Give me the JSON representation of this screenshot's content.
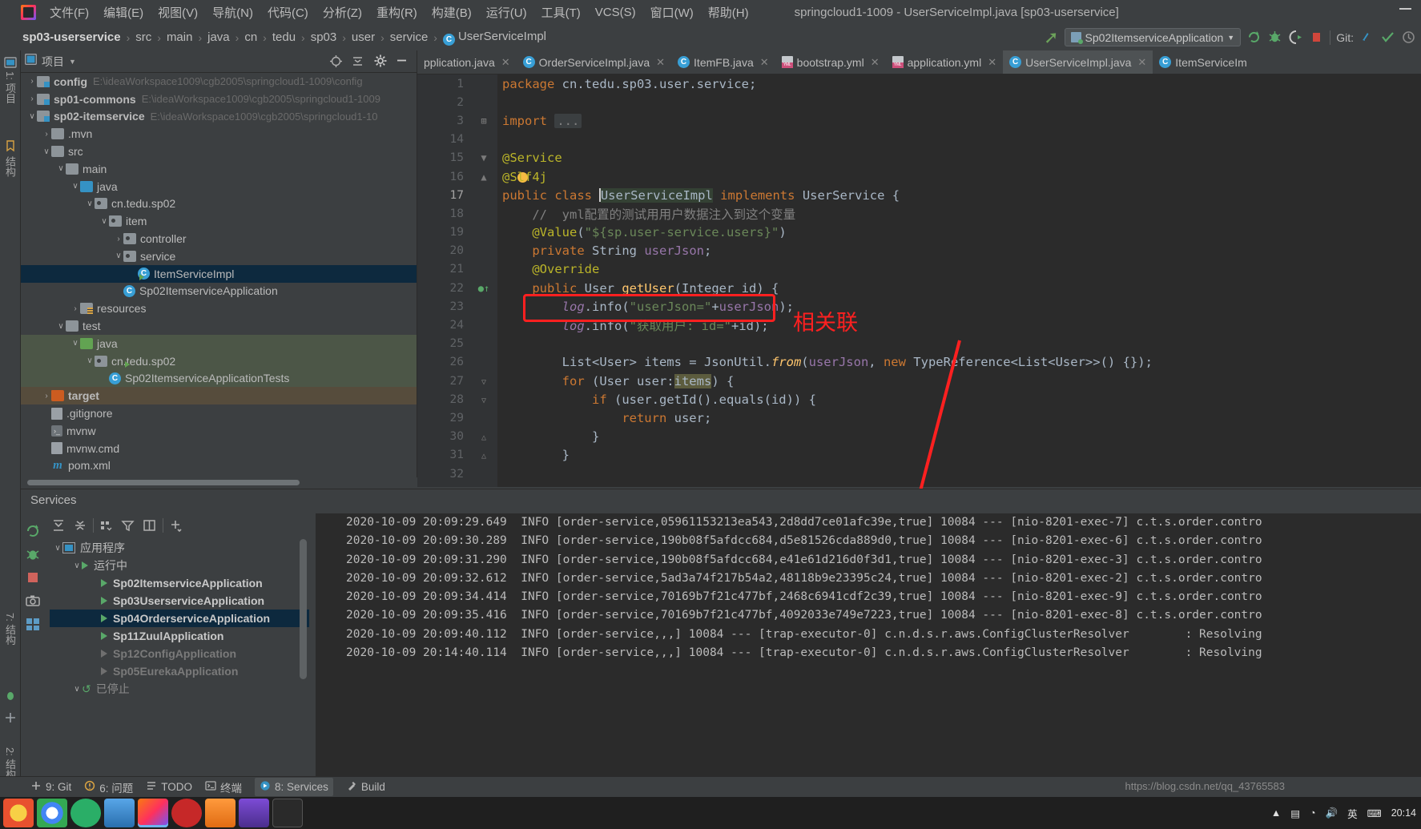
{
  "window": {
    "title": "springcloud1-1009 - UserServiceImpl.java [sp03-userservice]",
    "minimize_label": "—"
  },
  "menubar": {
    "logo": "intellij-logo",
    "items": [
      {
        "label": "文件(F)"
      },
      {
        "label": "编辑(E)"
      },
      {
        "label": "视图(V)"
      },
      {
        "label": "导航(N)"
      },
      {
        "label": "代码(C)"
      },
      {
        "label": "分析(Z)"
      },
      {
        "label": "重构(R)"
      },
      {
        "label": "构建(B)"
      },
      {
        "label": "运行(U)"
      },
      {
        "label": "工具(T)"
      },
      {
        "label": "VCS(S)"
      },
      {
        "label": "窗口(W)"
      },
      {
        "label": "帮助(H)"
      }
    ]
  },
  "navbar": {
    "breadcrumb": [
      "sp03-userservice",
      "src",
      "main",
      "java",
      "cn",
      "tedu",
      "sp03",
      "user",
      "service"
    ],
    "breadcrumb_last": "UserServiceImpl",
    "breadcrumb_last_badge": "C",
    "run_config": "Sp02ItemserviceApplication",
    "git_label": "Git:",
    "icons": [
      "back-arrow-icon",
      "run-config-icon",
      "chevron-down-icon",
      "rerun-icon",
      "debug-icon",
      "run-with-coverage-icon",
      "stop-icon",
      "git-update-icon",
      "git-commit-icon",
      "history-icon"
    ]
  },
  "left_stripe": {
    "top_label": "1: 项目",
    "bottom_labels": [
      "2: 结构",
      "7: 结构"
    ]
  },
  "project_panel": {
    "title": "项目",
    "header_icons": [
      "locate-icon",
      "collapse-all-icon",
      "settings-gear-icon",
      "hide-icon"
    ],
    "tree": [
      {
        "depth": 0,
        "arrow": "›",
        "icon": "module",
        "label": "config",
        "bold": true,
        "path": "E:\\ideaWorkspace1009\\cgb2005\\springcloud1-1009\\config"
      },
      {
        "depth": 0,
        "arrow": "›",
        "icon": "module",
        "label": "sp01-commons",
        "bold": true,
        "path": "E:\\ideaWorkspace1009\\cgb2005\\springcloud1-1009"
      },
      {
        "depth": 0,
        "arrow": "∨",
        "icon": "module",
        "label": "sp02-itemservice",
        "bold": true,
        "path": "E:\\ideaWorkspace1009\\cgb2005\\springcloud1-10"
      },
      {
        "depth": 1,
        "arrow": "›",
        "icon": "folder",
        "label": ".mvn",
        "bold": false,
        "path": ""
      },
      {
        "depth": 1,
        "arrow": "∨",
        "icon": "folder",
        "label": "src",
        "bold": false,
        "path": ""
      },
      {
        "depth": 2,
        "arrow": "∨",
        "icon": "folder",
        "label": "main",
        "bold": false,
        "path": ""
      },
      {
        "depth": 3,
        "arrow": "∨",
        "icon": "src",
        "label": "java",
        "bold": false,
        "path": ""
      },
      {
        "depth": 4,
        "arrow": "∨",
        "icon": "pkg",
        "label": "cn.tedu.sp02",
        "bold": false,
        "path": ""
      },
      {
        "depth": 5,
        "arrow": "∨",
        "icon": "pkg",
        "label": "item",
        "bold": false,
        "path": ""
      },
      {
        "depth": 6,
        "arrow": "›",
        "icon": "pkg",
        "label": "controller",
        "bold": false,
        "path": ""
      },
      {
        "depth": 6,
        "arrow": "∨",
        "icon": "pkg",
        "label": "service",
        "bold": false,
        "path": ""
      },
      {
        "depth": 7,
        "arrow": "",
        "icon": "class",
        "label": "ItemServiceImpl",
        "bold": false,
        "path": "",
        "selected": true
      },
      {
        "depth": 6,
        "arrow": "",
        "icon": "class-run",
        "label": "Sp02ItemserviceApplication",
        "bold": false,
        "path": ""
      },
      {
        "depth": 3,
        "arrow": "›",
        "icon": "res",
        "label": "resources",
        "bold": false,
        "path": ""
      },
      {
        "depth": 2,
        "arrow": "∨",
        "icon": "folder",
        "label": "test",
        "bold": false,
        "path": ""
      },
      {
        "depth": 3,
        "arrow": "∨",
        "icon": "testsrc",
        "label": "java",
        "bold": false,
        "path": "",
        "scope": "test"
      },
      {
        "depth": 4,
        "arrow": "∨",
        "icon": "pkg",
        "label": "cn.tedu.sp02",
        "bold": false,
        "path": "",
        "scope": "test"
      },
      {
        "depth": 5,
        "arrow": "",
        "icon": "class-run",
        "label": "Sp02ItemserviceApplicationTests",
        "bold": false,
        "path": "",
        "scope": "test"
      },
      {
        "depth": 1,
        "arrow": "›",
        "icon": "target",
        "label": "target",
        "bold": true,
        "path": "",
        "scope": "target"
      },
      {
        "depth": 1,
        "arrow": "",
        "icon": "gitignore",
        "label": ".gitignore",
        "bold": false,
        "path": ""
      },
      {
        "depth": 1,
        "arrow": "",
        "icon": "script",
        "label": "mvnw",
        "bold": false,
        "path": ""
      },
      {
        "depth": 1,
        "arrow": "",
        "icon": "file",
        "label": "mvnw.cmd",
        "bold": false,
        "path": ""
      },
      {
        "depth": 1,
        "arrow": "",
        "icon": "maven",
        "label": "pom.xml",
        "bold": false,
        "path": ""
      }
    ]
  },
  "editor_tabs": [
    {
      "label": "pplication.java",
      "icon": "",
      "active": false,
      "closable": true,
      "clipped": true
    },
    {
      "label": "OrderServiceImpl.java",
      "icon": "class",
      "active": false,
      "closable": true
    },
    {
      "label": "ItemFB.java",
      "icon": "class",
      "active": false,
      "closable": true
    },
    {
      "label": "bootstrap.yml",
      "icon": "yml",
      "active": false,
      "closable": true
    },
    {
      "label": "application.yml",
      "icon": "yml",
      "active": false,
      "closable": true
    },
    {
      "label": "UserServiceImpl.java",
      "icon": "class",
      "active": true,
      "closable": true
    },
    {
      "label": "ItemServiceIm",
      "icon": "class",
      "active": false,
      "closable": false,
      "clipped": true
    }
  ],
  "code": {
    "lines": [
      {
        "n": "1",
        "text": "package cn.tedu.sp03.user.service;"
      },
      {
        "n": "2",
        "text": ""
      },
      {
        "n": "3",
        "text": "import ...",
        "fold": true
      },
      {
        "n": "14",
        "text": ""
      },
      {
        "n": "15",
        "text": "@Service"
      },
      {
        "n": "16",
        "text": "@Slf4j"
      },
      {
        "n": "17",
        "text": "public class UserServiceImpl implements UserService {",
        "current": true
      },
      {
        "n": "18",
        "text": "    //  yml配置的测试用用户数据注入到这个变量"
      },
      {
        "n": "19",
        "text": "    @Value(\"${sp.user-service.users}\")"
      },
      {
        "n": "20",
        "text": "    private String userJson;"
      },
      {
        "n": "21",
        "text": "    @Override"
      },
      {
        "n": "22",
        "text": "    public User getUser(Integer id) {"
      },
      {
        "n": "23",
        "text": "        log.info(\"userJson=\"+userJson);"
      },
      {
        "n": "24",
        "text": "        log.info(\"获取用户: id=\"+id);"
      },
      {
        "n": "25",
        "text": ""
      },
      {
        "n": "26",
        "text": "        List<User> items = JsonUtil.from(userJson, new TypeReference<List<User>>() {});"
      },
      {
        "n": "27",
        "text": "        for (User user:items) {"
      },
      {
        "n": "28",
        "text": "            if (user.getId().equals(id)) {"
      },
      {
        "n": "29",
        "text": "                return user;"
      },
      {
        "n": "30",
        "text": "            }"
      },
      {
        "n": "31",
        "text": "        }"
      },
      {
        "n": "32",
        "text": ""
      }
    ]
  },
  "annotation": {
    "label": "相关联",
    "color": "#ff2020",
    "box1": "highlight around log.info(userJson) statement",
    "box2": "highlight around console log block",
    "arrow": "arrow-connector"
  },
  "services": {
    "title": "Services",
    "rail_icons": [
      "rerun-icon",
      "debug-icon",
      "stop-icon",
      "camera-icon",
      "settings-icon"
    ],
    "toolbar_icons": [
      "expand-all-icon",
      "collapse-all-icon",
      "group-icon",
      "filter-icon",
      "show-toolbar-icon",
      "add-icon"
    ],
    "tree": [
      {
        "depth": 0,
        "arrow": "∨",
        "icon": "app",
        "label": "应用程序",
        "bold": false,
        "dim": false
      },
      {
        "depth": 1,
        "arrow": "∨",
        "icon": "run",
        "label": "运行中",
        "bold": false,
        "dim": false
      },
      {
        "depth": 2,
        "arrow": "",
        "icon": "tri",
        "label": "Sp02ItemserviceApplication",
        "bold": true,
        "dim": false
      },
      {
        "depth": 2,
        "arrow": "",
        "icon": "tri",
        "label": "Sp03UserserviceApplication",
        "bold": true,
        "dim": false
      },
      {
        "depth": 2,
        "arrow": "",
        "icon": "tri",
        "label": "Sp04OrderserviceApplication",
        "bold": true,
        "dim": false,
        "selected": true
      },
      {
        "depth": 2,
        "arrow": "",
        "icon": "tri",
        "label": "Sp11ZuulApplication",
        "bold": true,
        "dim": false
      },
      {
        "depth": 2,
        "arrow": "",
        "icon": "tri-dim",
        "label": "Sp12ConfigApplication",
        "bold": true,
        "dim": true
      },
      {
        "depth": 2,
        "arrow": "",
        "icon": "tri-dim",
        "label": "Sp05EurekaApplication",
        "bold": true,
        "dim": true
      },
      {
        "depth": 1,
        "arrow": "∨",
        "icon": "stopped",
        "label": "已停止",
        "bold": false,
        "dim": true
      }
    ]
  },
  "console": {
    "lines": [
      "2020-10-09 20:09:29.649  INFO [order-service,05961153213ea543,2d8dd7ce01afc39e,true] 10084 --- [nio-8201-exec-7] c.t.s.order.contro",
      "2020-10-09 20:09:30.289  INFO [order-service,190b08f5afdcc684,d5e81526cda889d0,true] 10084 --- [nio-8201-exec-6] c.t.s.order.contro",
      "2020-10-09 20:09:31.290  INFO [order-service,190b08f5afdcc684,e41e61d216d0f3d1,true] 10084 --- [nio-8201-exec-3] c.t.s.order.contro",
      "2020-10-09 20:09:32.612  INFO [order-service,5ad3a74f217b54a2,48118b9e23395c24,true] 10084 --- [nio-8201-exec-2] c.t.s.order.contro",
      "2020-10-09 20:09:34.414  INFO [order-service,70169b7f21c477bf,2468c6941cdf2c39,true] 10084 --- [nio-8201-exec-9] c.t.s.order.contro",
      "2020-10-09 20:09:35.416  INFO [order-service,70169b7f21c477bf,4092033e749e7223,true] 10084 --- [nio-8201-exec-8] c.t.s.order.contro",
      "2020-10-09 20:09:40.112  INFO [order-service,,,] 10084 --- [trap-executor-0] c.n.d.s.r.aws.ConfigClusterResolver        : Resolving",
      "2020-10-09 20:14:40.114  INFO [order-service,,,] 10084 --- [trap-executor-0] c.n.d.s.r.aws.ConfigClusterResolver        : Resolving"
    ]
  },
  "statusbar": {
    "items": [
      {
        "label": "9: Git",
        "icon": "git-icon",
        "active": false
      },
      {
        "label": "6: 问题",
        "icon": "inspection-icon",
        "active": false
      },
      {
        "label": "TODO",
        "icon": "todo-icon",
        "active": false
      },
      {
        "label": "终端",
        "icon": "terminal-icon",
        "active": false
      },
      {
        "label": "8: Services",
        "icon": "services-icon",
        "active": true
      },
      {
        "label": "Build",
        "icon": "build-icon",
        "active": false
      }
    ],
    "watermark": "https://blog.csdn.net/qq_43765583"
  },
  "taskbar": {
    "apps": [
      "start-icon",
      "chrome-icon",
      "wechat-icon",
      "folder-icon",
      "idea-icon",
      "music-icon",
      "image-icon",
      "code-icon",
      "terminal-icon"
    ],
    "tray": [
      "chevron-up-icon",
      "monitor-icon",
      "network-icon",
      "volume-icon",
      "ime-英",
      "keyboard-icon"
    ],
    "clock": "20:14"
  }
}
